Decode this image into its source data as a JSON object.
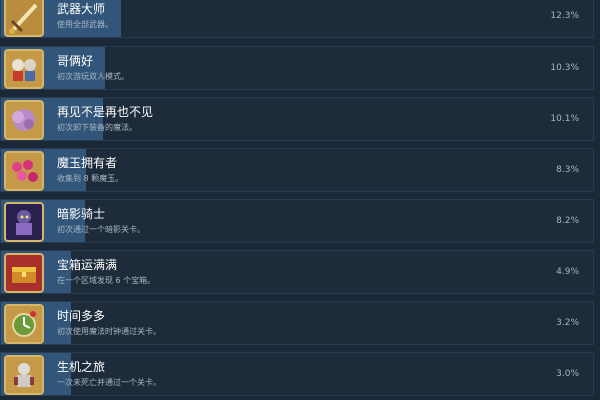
{
  "colors": {
    "background": "#1b2838",
    "row": "#1e2b3b",
    "progress_fill": "#3a6690",
    "title": "#ffffff",
    "subtext": "#a8b6c4",
    "icon_frame": "#c7a052"
  },
  "achievements": [
    {
      "title": "武器大师",
      "desc": "使用全部武器。",
      "percent": "12.3%",
      "fraction": 0.123,
      "icon": "sword-icon"
    },
    {
      "title": "哥俩好",
      "desc": "初次游玩双人模式。",
      "percent": "10.3%",
      "fraction": 0.103,
      "icon": "two-heroes-icon"
    },
    {
      "title": "再见不是再也不见",
      "desc": "初次卸下装备的魔法。",
      "percent": "10.1%",
      "fraction": 0.101,
      "icon": "magic-cloud-icon"
    },
    {
      "title": "魔玉拥有者",
      "desc": "收集到 8 颗魔玉。",
      "percent": "8.3%",
      "fraction": 0.083,
      "icon": "magic-gems-icon"
    },
    {
      "title": "暗影骑士",
      "desc": "初次通过一个暗影关卡。",
      "percent": "8.2%",
      "fraction": 0.082,
      "icon": "shadow-knight-icon"
    },
    {
      "title": "宝箱运满满",
      "desc": "在一个区域发现 6 个宝箱。",
      "percent": "4.9%",
      "fraction": 0.049,
      "icon": "treasure-chest-icon"
    },
    {
      "title": "时间多多",
      "desc": "初次使用魔法时钟通过关卡。",
      "percent": "3.2%",
      "fraction": 0.032,
      "icon": "magic-clock-icon"
    },
    {
      "title": "生机之旅",
      "desc": "一次未死亡并通过一个关卡。",
      "percent": "3.0%",
      "fraction": 0.03,
      "icon": "knight-icon"
    }
  ]
}
